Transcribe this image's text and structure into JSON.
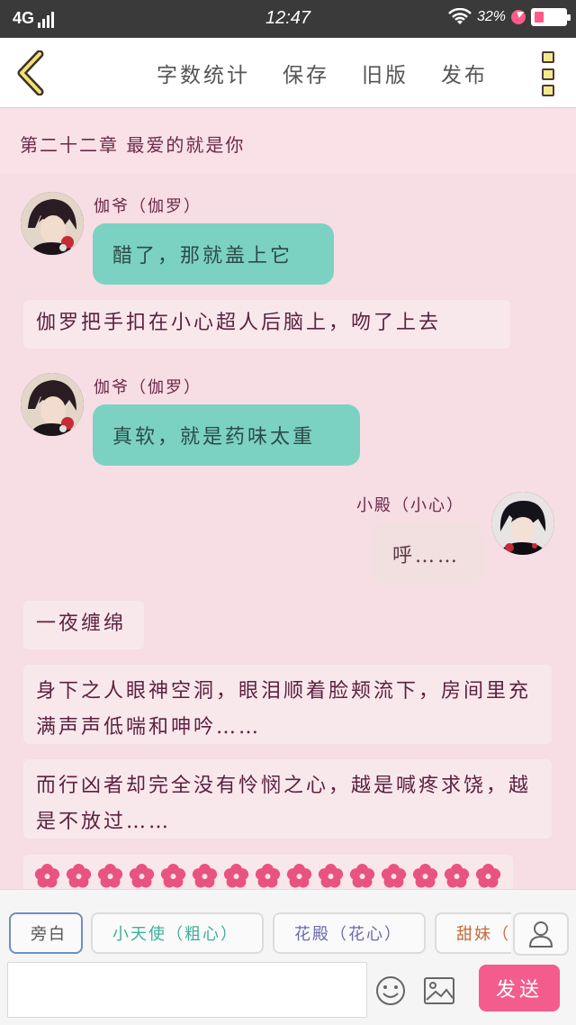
{
  "status_bar": {
    "network": "4G",
    "time": "12:47",
    "battery": "32%",
    "battery_level": 0.32
  },
  "header": {
    "menu": [
      "字数统计",
      "保存",
      "旧版",
      "发布"
    ]
  },
  "chapter_title": "第二十二章 最爱的就是你",
  "messages": [
    {
      "speaker": "伽爷（伽罗）",
      "text": "醋了，那就盖上它"
    },
    {
      "narration": "伽罗把手扣在小心超人后脑上，吻了上去"
    },
    {
      "speaker": "伽爷（伽罗）",
      "text": "真软，就是药味太重"
    },
    {
      "speaker": "小殿（小心）",
      "text": "呼……"
    },
    {
      "narration": "一夜缠绵"
    },
    {
      "narration": "身下之人眼神空洞，眼泪顺着脸颊流下，房间里充满声声低喘和呻吟……"
    },
    {
      "narration": "而行凶者却完全没有怜悯之心，越是喊疼求饶，越是不放过……"
    }
  ],
  "flower_row_count": 15,
  "colors": {
    "teal_bubble": "#7cd2c2",
    "self_bubble": "#f2e0e0",
    "background": "#f7dde4",
    "send_button": "#f45c8e",
    "flower": "#e9537f"
  },
  "roles": [
    {
      "label": "旁白",
      "color": "#666666"
    },
    {
      "label": "小天使（粗心）",
      "color": "#3fae9a"
    },
    {
      "label": "花殿（花心）",
      "color": "#6a6ab0"
    },
    {
      "label": "甜妹（",
      "color": "#c46a3a"
    }
  ],
  "input": {
    "placeholder": ""
  },
  "send_label": "发送",
  "icons": [
    "back-icon",
    "more-icon",
    "user-icon",
    "emoji-icon",
    "image-icon",
    "flower-icon"
  ]
}
